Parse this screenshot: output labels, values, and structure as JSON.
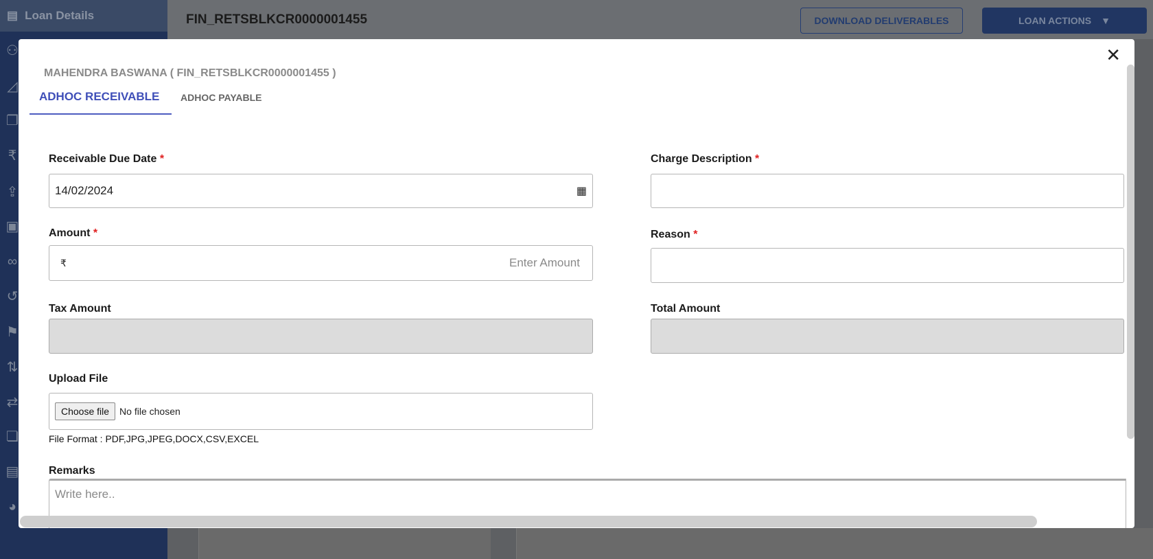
{
  "sidebar": {
    "top_label": "Loan Details",
    "icons": [
      "document-icon",
      "user-icon",
      "chart-icon",
      "copy-icon",
      "rupee-icon",
      "upload-cash-icon",
      "calendar-icon",
      "link-icon",
      "history-icon",
      "bookmark-icon",
      "pull-request-icon",
      "transfer-icon",
      "pages-icon",
      "receipt-icon",
      "pie-icon"
    ]
  },
  "header": {
    "title": "FIN_RETSBLKCR0000001455",
    "download_label": "DOWNLOAD DELIVERABLES",
    "loan_actions_label": "LOAN ACTIONS"
  },
  "modal": {
    "title": "MAHENDRA BASWANA ( FIN_RETSBLKCR0000001455 )",
    "tabs": [
      {
        "label": "ADHOC RECEIVABLE",
        "active": true
      },
      {
        "label": "ADHOC PAYABLE",
        "active": false
      }
    ],
    "fields": {
      "due_date": {
        "label": "Receivable Due Date",
        "value": "14/02/2024"
      },
      "charge_description": {
        "label": "Charge Description",
        "value": ""
      },
      "amount": {
        "label": "Amount",
        "currency": "₹",
        "placeholder": "Enter Amount"
      },
      "reason": {
        "label": "Reason",
        "value": ""
      },
      "tax_amount": {
        "label": "Tax Amount",
        "value": ""
      },
      "total_amount": {
        "label": "Total Amount",
        "value": ""
      },
      "upload": {
        "label": "Upload File",
        "button": "Choose file",
        "status": "No file chosen",
        "formats": "File Format : PDF,JPG,JPEG,DOCX,CSV,EXCEL"
      },
      "remarks": {
        "label": "Remarks",
        "placeholder": "Write here.."
      }
    },
    "required_mark": "*"
  },
  "colors": {
    "accent": "#3f4fb8",
    "brand_navy": "#213662",
    "required": "#e02020"
  }
}
